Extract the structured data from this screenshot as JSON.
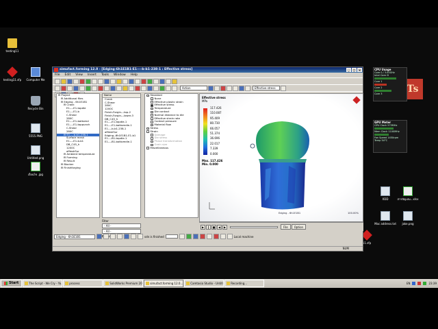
{
  "desktop": {
    "icons_left": [
      {
        "label": "testing11",
        "kind": "folder"
      },
      {
        "label": "testing11.sfp",
        "kind": "redgem"
      },
      {
        "label": "Computer Me",
        "kind": "pc"
      },
      {
        "label": "Recycle Bin",
        "kind": "bin"
      },
      {
        "label": "5555.PNG",
        "kind": "img"
      },
      {
        "label": "Untitled.png",
        "kind": "img"
      },
      {
        "label": "เงื่อนไข .jpg",
        "kind": "greenfile"
      }
    ],
    "icons_right": [
      {
        "label": "XDD",
        "kind": "img"
      },
      {
        "label": "สารบัญเล่ม...xlsx",
        "kind": "greenfile"
      },
      {
        "label": "Mac address.txt",
        "kind": "img"
      },
      {
        "label": "joke.png",
        "kind": "img"
      },
      {
        "label": "11.sfp",
        "kind": "redgem"
      }
    ],
    "logo_text": "Ts",
    "cpu_gadget": {
      "title": "CPU Usage",
      "lines": [
        "Core 0 / 3.00GHz",
        "Intel Core i5",
        "Core 1",
        "Core 2",
        "Core 3"
      ]
    },
    "gpu_gadget": {
      "title": "GPU Meter",
      "lines": [
        "GPU Clock 575MHz",
        "Mem Clock 1100MHz",
        "Fan Speed 1450rpm",
        "Temp 54°C"
      ]
    }
  },
  "window": {
    "title": "simufact.forming 12.0 - [Edging-6h1E1B1-E1----b-b1-238-1 : Effective stress]",
    "menu": [
      "File",
      "Edit",
      "View",
      "Insert",
      "Tools",
      "Window",
      "Help"
    ],
    "combo_action": "Action",
    "combo_result": "Effective stress",
    "tree": [
      {
        "label": "Project",
        "level": 0
      },
      {
        "label": "Additional files",
        "level": 1
      },
      {
        "label": "Edging - 6h1E1B1",
        "level": 1
      },
      {
        "label": "Crank",
        "level": 2
      },
      {
        "label": "E1----E1-topdie",
        "level": 3
      },
      {
        "label": "E1----E1-b",
        "level": 3
      },
      {
        "label": "C-Shear",
        "level": 3
      },
      {
        "label": "280C",
        "level": 3
      },
      {
        "label": "E1----E1-bottomd",
        "level": 3
      },
      {
        "label": "E1----E1-toppunch",
        "level": 3
      },
      {
        "label": "C-Shear",
        "level": 3
      },
      {
        "label": "280C",
        "level": 3
      },
      {
        "label": "E1----b-b1-238-1",
        "level": 2,
        "selected": true
      },
      {
        "label": "Surface mesh",
        "level": 3
      },
      {
        "label": "E1----E1-b-b1",
        "level": 3
      },
      {
        "label": "DB_C45_h",
        "level": 3
      },
      {
        "label": "1200C",
        "level": 3
      },
      {
        "label": "aMeshSur",
        "level": 3
      },
      {
        "label": "Ambient temperature",
        "level": 2
      },
      {
        "label": "Forming",
        "level": 2
      },
      {
        "label": "Result",
        "level": 2
      },
      {
        "label": "Blocker",
        "level": 1
      },
      {
        "label": "Finishforging",
        "level": 1
      }
    ],
    "list_header": "Name",
    "list": [
      "Crank",
      "C-Shear",
      "280C",
      "1200C",
      "Finish-Forgin---top-2",
      "Finish-Forgin---lower-3",
      "DB_C45_h",
      "E1----E1-topdie-1",
      "E1----E1-bottomdie-1",
      "E1----b-b1-238-1",
      "aMeshSur",
      "Edging--6h1E1B1-E1-b1",
      "E1----B1-topdie-1",
      "E1----B1-bottomdie-1"
    ],
    "filter_label": "Filter",
    "filter_value": "- All -",
    "filter_value2": "- All -",
    "inverse_label": "Inverse",
    "result_groups": [
      {
        "label": "Standard",
        "checked": false,
        "grey": false
      },
      {
        "label": "None",
        "checked": false,
        "grey": false
      },
      {
        "label": "Effective plastic strain",
        "checked": false,
        "grey": false
      },
      {
        "label": "Effective stress",
        "checked": true,
        "grey": false
      },
      {
        "label": "Temperature",
        "checked": false,
        "grey": false
      },
      {
        "label": "Die contact",
        "checked": false,
        "grey": false
      },
      {
        "label": "Normal distance to die",
        "checked": false,
        "grey": false
      },
      {
        "label": "Effective strain rate",
        "checked": false,
        "grey": false
      },
      {
        "label": "Contact pressure",
        "checked": false,
        "grey": false
      },
      {
        "label": "Material flow",
        "checked": false,
        "grey": false
      },
      {
        "label": "Stress",
        "checked": false,
        "grey": false
      },
      {
        "label": "Strain",
        "checked": false,
        "grey": false
      },
      {
        "label": "Damage",
        "checked": false,
        "grey": true
      },
      {
        "label": "Die stress",
        "checked": false,
        "grey": true
      },
      {
        "label": "Phase transformation",
        "checked": false,
        "grey": true
      },
      {
        "label": "Grain size",
        "checked": false,
        "grey": true
      },
      {
        "label": "Miscellaneous",
        "checked": false,
        "grey": false
      }
    ],
    "legend": {
      "title": "Effective stress",
      "unit": "MPa",
      "values": [
        "117.426",
        "110.087",
        "95.409",
        "80.730",
        "66.057",
        "51.374",
        "36.696",
        "22.017",
        "7.339",
        "0.000"
      ],
      "max_label": "Max.",
      "max_value": "117.426",
      "min_label": "Min.",
      "min_value": "0.000"
    },
    "viewport_caption": "Edging - 6h1E1B1",
    "zoom_text": "100.00%",
    "playback": {
      "file_label": "File",
      "option_label": "Option"
    },
    "status_combo": "Edging - 6h1E1B1",
    "status_text": "sdn is finished",
    "local_machine": "Local machine",
    "statusbar_right": "NUM"
  },
  "taskbar": {
    "start": "Start",
    "tasks": [
      {
        "label": "The Script - We Cry - Yo...",
        "active": false
      },
      {
        "label": "process",
        "active": false
      },
      {
        "label": "SolidWorks Premium 20...",
        "active": false
      },
      {
        "label": "simufact.forming 12.0...",
        "active": true
      },
      {
        "label": "Camtasia Studio - Untitle...",
        "active": false
      },
      {
        "label": "Recording...",
        "active": false
      }
    ],
    "lang": "EN",
    "clock": "23:39"
  }
}
